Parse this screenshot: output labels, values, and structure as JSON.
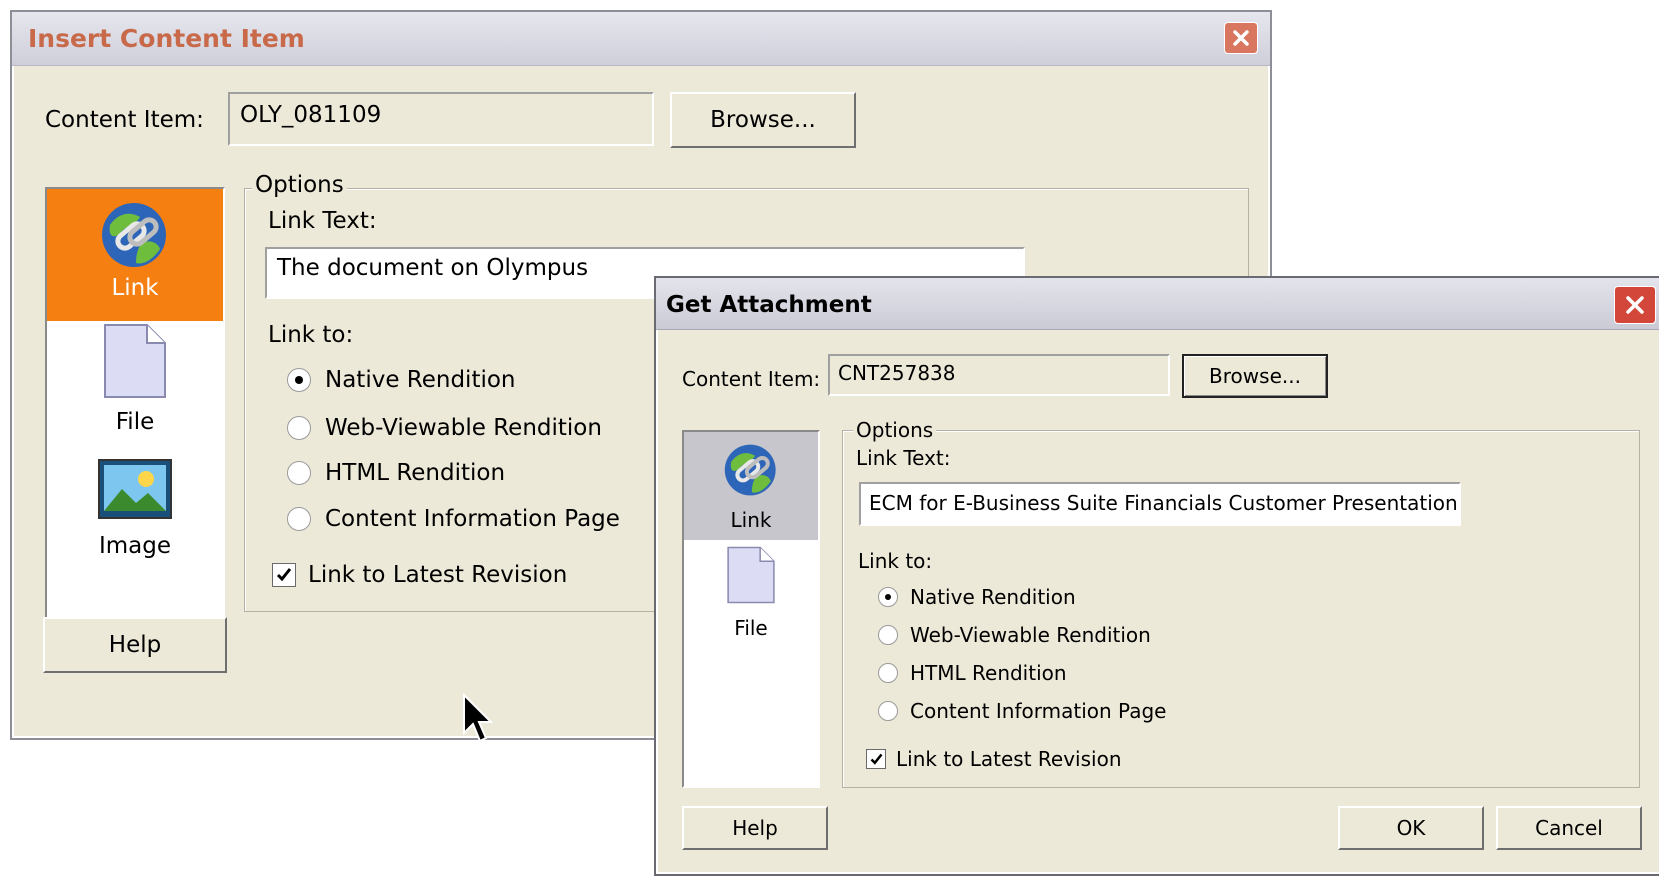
{
  "colors": {
    "face": "#ece9d8",
    "title_active": "#cfcfd8",
    "title_inactive": "#dcdce4",
    "title_text_inactive": "#c86a4a",
    "selected_orange": "#f67f12",
    "selected_gray": "#c6c6cc",
    "close_red": "#d2473a"
  },
  "insert_dialog": {
    "title": "Insert Content Item",
    "content_item_label": "Content Item:",
    "content_item_value": "OLY_081109",
    "browse_label": "Browse...",
    "sidebar": [
      {
        "label": "Link",
        "icon": "globe-chain-icon",
        "selected": true
      },
      {
        "label": "File",
        "icon": "file-icon",
        "selected": false
      },
      {
        "label": "Image",
        "icon": "image-icon",
        "selected": false
      }
    ],
    "options_legend": "Options",
    "link_text_label": "Link Text:",
    "link_text_value": "The document on Olympus",
    "link_to_label": "Link to:",
    "radios": [
      {
        "label": "Native Rendition",
        "checked": true
      },
      {
        "label": "Web-Viewable Rendition",
        "checked": false
      },
      {
        "label": "HTML Rendition",
        "checked": false
      },
      {
        "label": "Content Information Page",
        "checked": false
      }
    ],
    "latest_revision_label": "Link to Latest Revision",
    "latest_revision_checked": true,
    "help_label": "Help"
  },
  "get_dialog": {
    "title": "Get Attachment",
    "content_item_label": "Content Item:",
    "content_item_value": "CNT257838",
    "browse_label": "Browse...",
    "sidebar": [
      {
        "label": "Link",
        "icon": "globe-chain-icon",
        "selected": true
      },
      {
        "label": "File",
        "icon": "file-icon",
        "selected": false
      }
    ],
    "options_legend": "Options",
    "link_text_label": "Link Text:",
    "link_text_value": "ECM for E-Business Suite Financials Customer Presentation",
    "link_to_label": "Link to:",
    "radios": [
      {
        "label": "Native Rendition",
        "checked": true
      },
      {
        "label": "Web-Viewable Rendition",
        "checked": false
      },
      {
        "label": "HTML Rendition",
        "checked": false
      },
      {
        "label": "Content Information Page",
        "checked": false
      }
    ],
    "latest_revision_label": "Link to Latest Revision",
    "latest_revision_checked": true,
    "help_label": "Help",
    "ok_label": "OK",
    "cancel_label": "Cancel"
  },
  "cursor": {
    "icon": "mouse-pointer-icon"
  }
}
